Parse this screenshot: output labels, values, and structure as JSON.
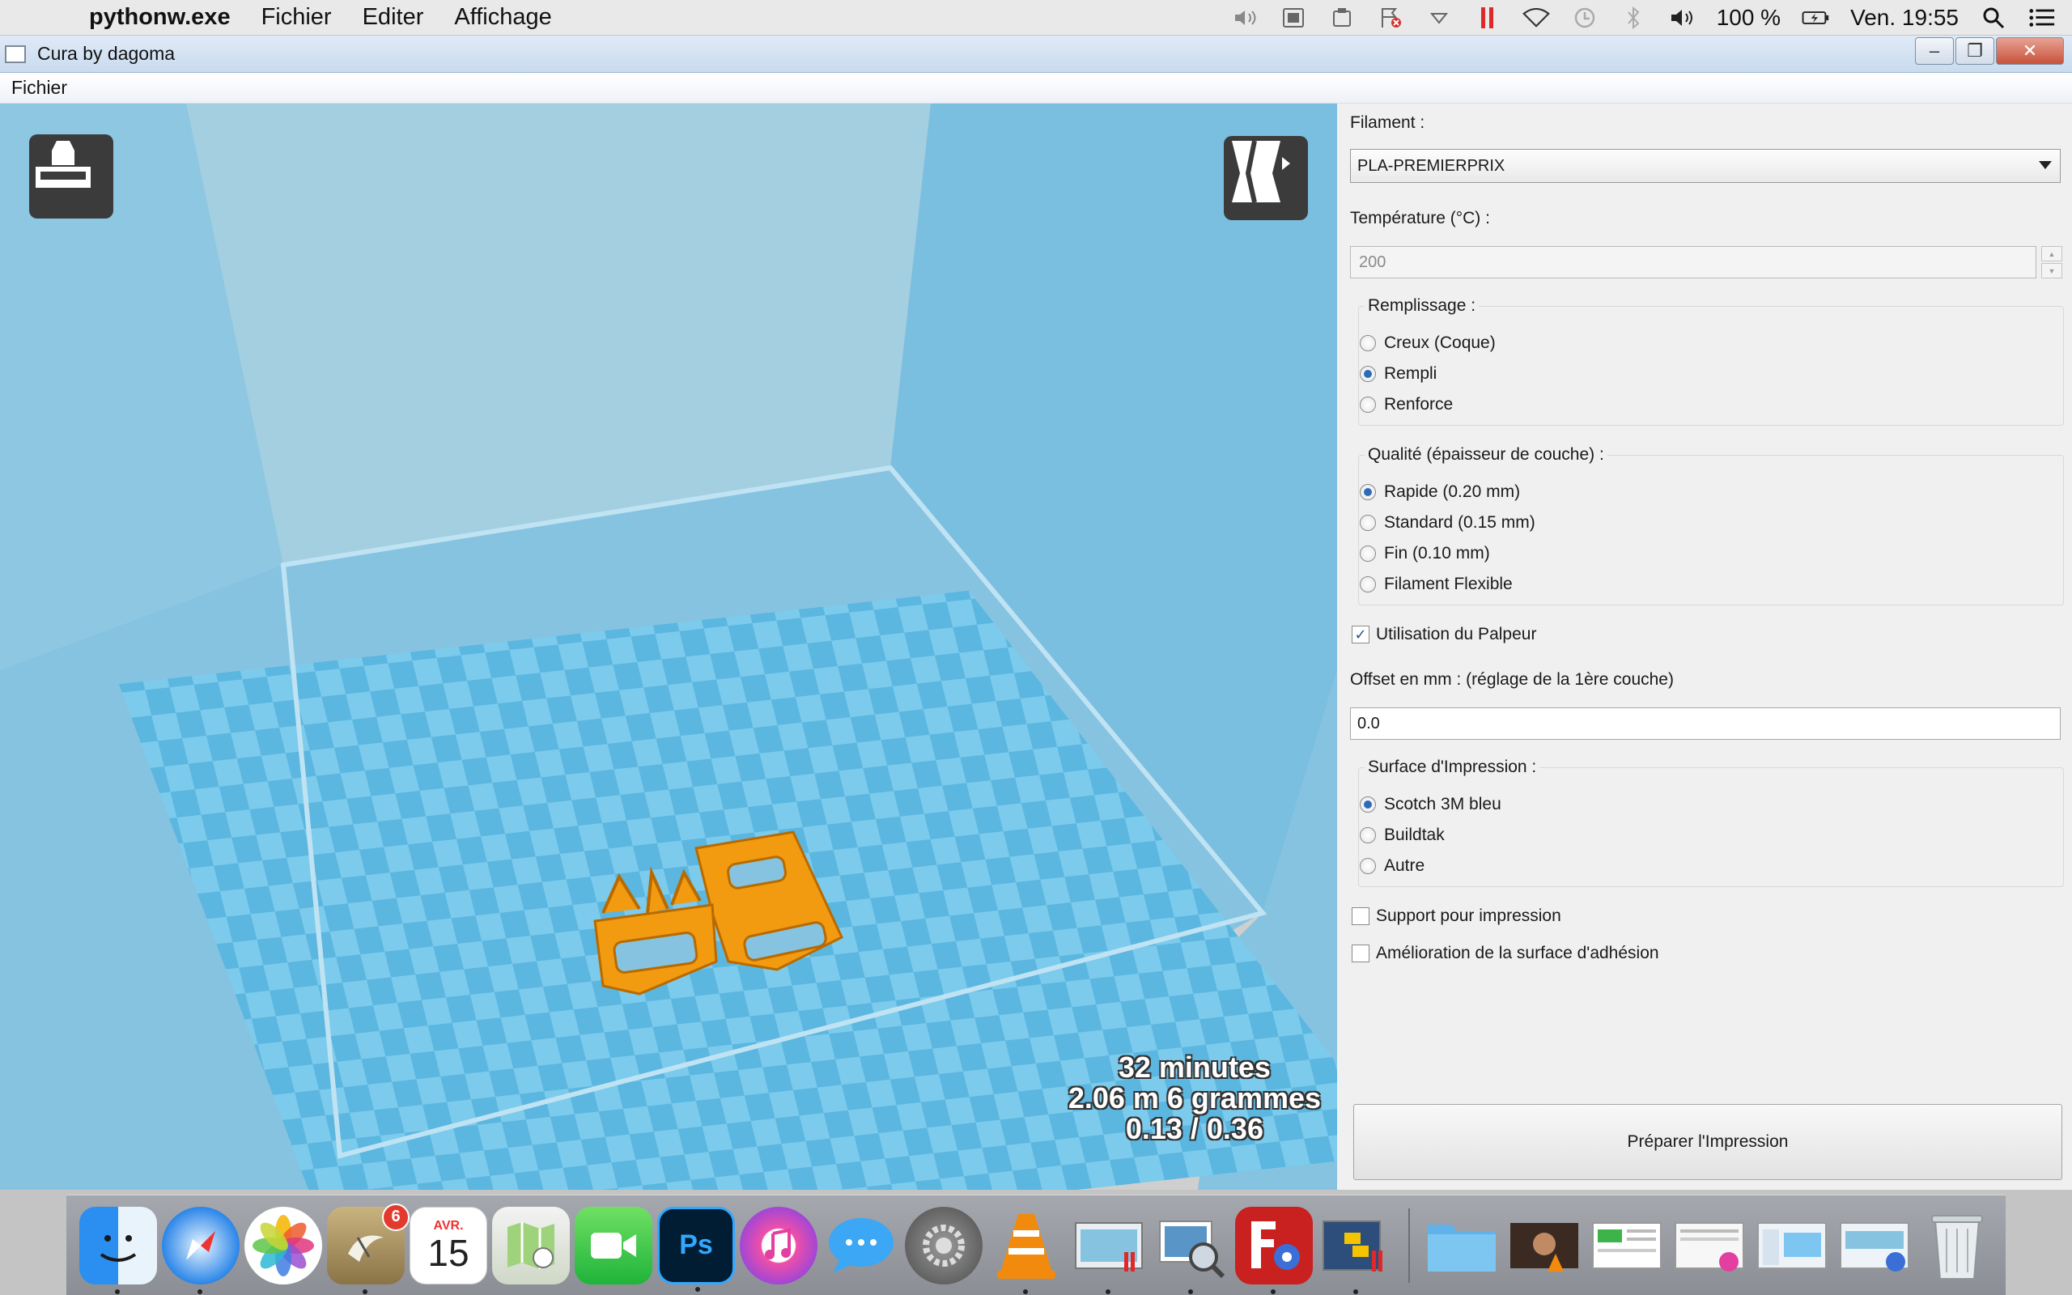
{
  "menubar": {
    "app_name": "pythonw.exe",
    "menus": [
      "Fichier",
      "Editer",
      "Affichage"
    ],
    "battery": "100 %",
    "clock": "Ven. 19:55"
  },
  "window": {
    "title": "Cura by dagoma",
    "menu": "Fichier",
    "close": "✕",
    "minimize": "–",
    "maximize": "❐"
  },
  "viewport": {
    "stats": [
      "32 minutes",
      "2.06 m 6 grammes",
      "0.13 / 0.36"
    ],
    "colors": {
      "build_volume": "#86c3e0",
      "object": "#f29a10"
    }
  },
  "panel": {
    "filament_label": "Filament :",
    "filament_value": "PLA-PREMIERPRIX",
    "temperature_label": "Température (°C) :",
    "temperature_value": "200",
    "infill_title": "Remplissage :",
    "infill_options": [
      "Creux (Coque)",
      "Rempli",
      "Renforce"
    ],
    "infill_selected": 1,
    "quality_title": "Qualité (épaisseur de couche) :",
    "quality_options": [
      "Rapide (0.20 mm)",
      "Standard (0.15 mm)",
      "Fin (0.10 mm)",
      "Filament Flexible"
    ],
    "quality_selected": 0,
    "probe_label": "Utilisation du Palpeur",
    "probe_checked": true,
    "offset_label": "Offset en mm : (réglage de la 1ère couche)",
    "offset_value": "0.0",
    "surface_title": "Surface d'Impression :",
    "surface_options": [
      "Scotch 3M bleu",
      "Buildtak",
      "Autre"
    ],
    "surface_selected": 0,
    "support_label": "Support pour impression",
    "adhesion_label": "Amélioration de la surface d'adhésion",
    "prepare_button": "Préparer l'Impression"
  },
  "dock": {
    "calendar_month": "AVR.",
    "calendar_day": "15",
    "mail_badge": "6",
    "photoshop_label": "Ps"
  }
}
